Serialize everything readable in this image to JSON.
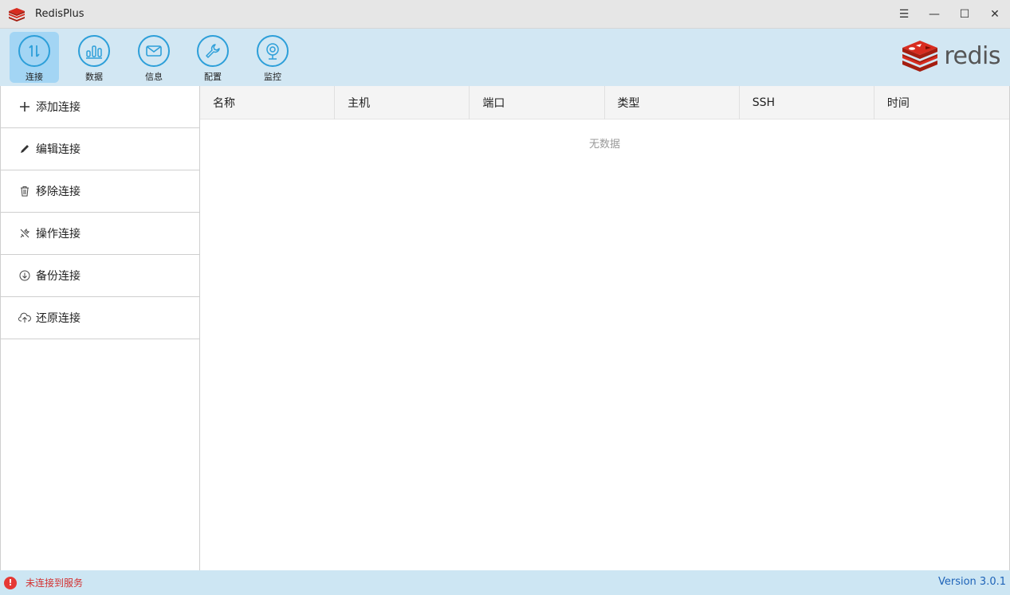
{
  "window": {
    "title": "RedisPlus",
    "controls": {
      "menu": "☰",
      "minimize": "—",
      "maximize": "☐",
      "close": "✕"
    }
  },
  "toolbar": {
    "items": [
      {
        "label": "连接",
        "icon": "connect-arrows-icon",
        "active": true
      },
      {
        "label": "数据",
        "icon": "bar-chart-icon",
        "active": false
      },
      {
        "label": "信息",
        "icon": "mail-icon",
        "active": false
      },
      {
        "label": "配置",
        "icon": "wrench-icon",
        "active": false
      },
      {
        "label": "监控",
        "icon": "webcam-icon",
        "active": false
      }
    ],
    "brand": "redis"
  },
  "sidebar": {
    "items": [
      {
        "label": "添加连接",
        "icon": "plus-icon"
      },
      {
        "label": "编辑连接",
        "icon": "pencil-icon"
      },
      {
        "label": "移除连接",
        "icon": "trash-icon"
      },
      {
        "label": "操作连接",
        "icon": "tools-icon"
      },
      {
        "label": "备份连接",
        "icon": "download-circle-icon"
      },
      {
        "label": "还原连接",
        "icon": "cloud-upload-icon"
      }
    ]
  },
  "table": {
    "columns": [
      "名称",
      "主机",
      "端口",
      "类型",
      "SSH",
      "时间"
    ],
    "empty_text": "无数据"
  },
  "status": {
    "icon_glyph": "!",
    "text": "未连接到服务",
    "version": "Version 3.0.1"
  },
  "colors": {
    "accent": "#2d9fd9",
    "toolbar_bg": "#d2e7f3",
    "active_tool_bg": "#a3d5f4",
    "status_error": "#d32f2f",
    "version_text": "#1e63b8",
    "redis_red": "#d82c20"
  }
}
